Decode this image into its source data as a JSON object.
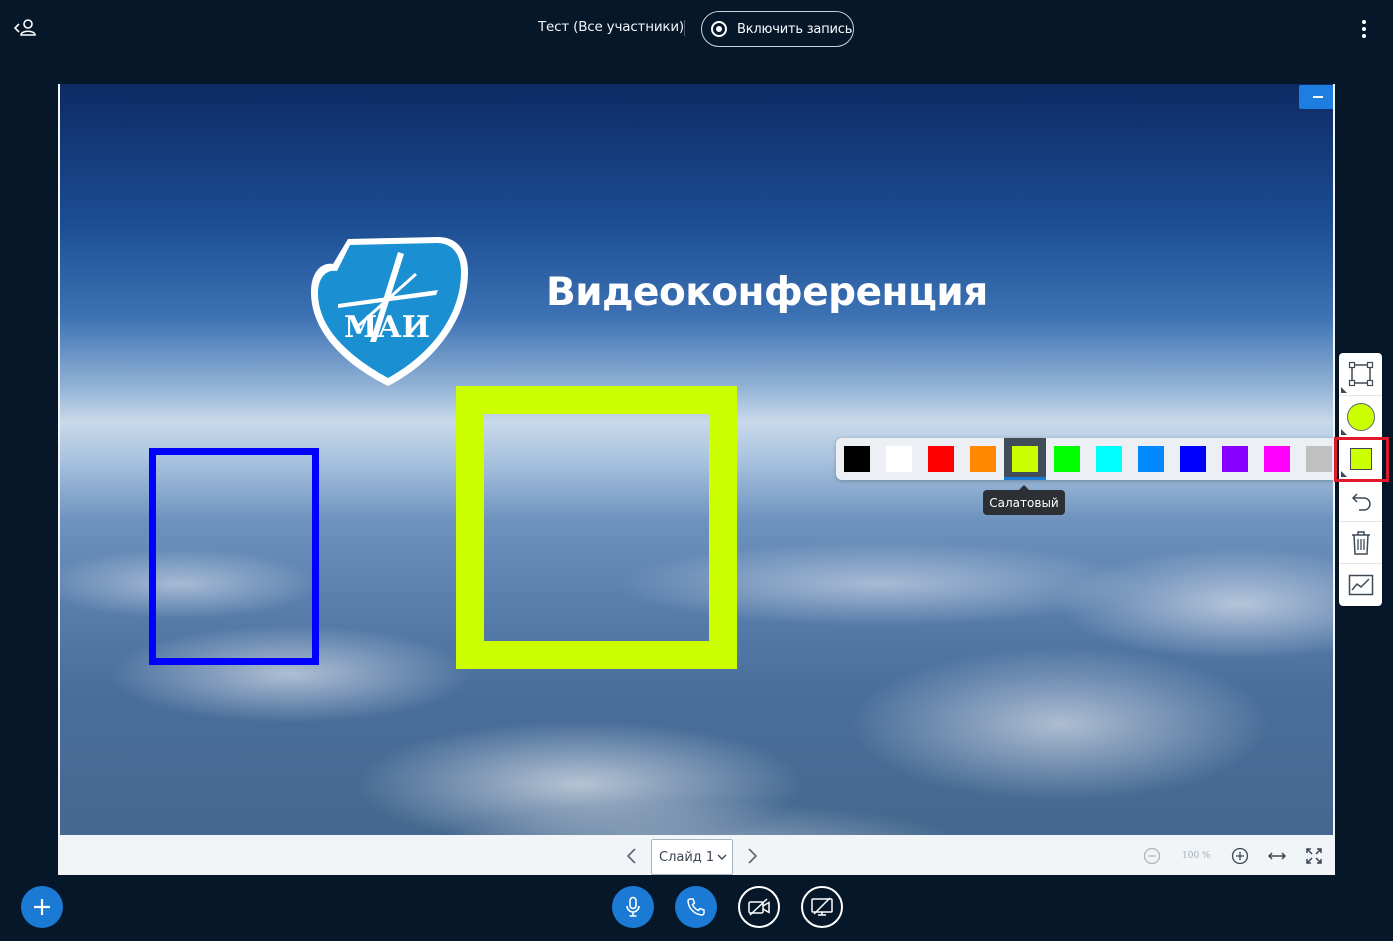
{
  "topbar": {
    "title": "Тест (Все участники)",
    "record_label": "Включить запись"
  },
  "slide": {
    "logo_text": "МАИ",
    "heading": "Видеоконференция"
  },
  "slide_nav": {
    "current_slide": "Слайд 1",
    "zoom": "100 %"
  },
  "palette": {
    "selected": "Салатовый",
    "colors": [
      "#000000",
      "#ffffff",
      "#ff0000",
      "#ff8800",
      "#ccff00",
      "#00ff00",
      "#00ffff",
      "#0088ff",
      "#0000ff",
      "#8800ff",
      "#ff00ff",
      "#c0c0c0"
    ],
    "tooltip": "Салатовый"
  },
  "tools": {
    "active_color": "#ccff00",
    "items": [
      "rectangle-tool",
      "thickness",
      "color",
      "undo",
      "clear",
      "multi-user"
    ]
  },
  "colors": {
    "accent": "#1b7ad3",
    "background": "#06172a",
    "highlight": "#e11a2b"
  }
}
